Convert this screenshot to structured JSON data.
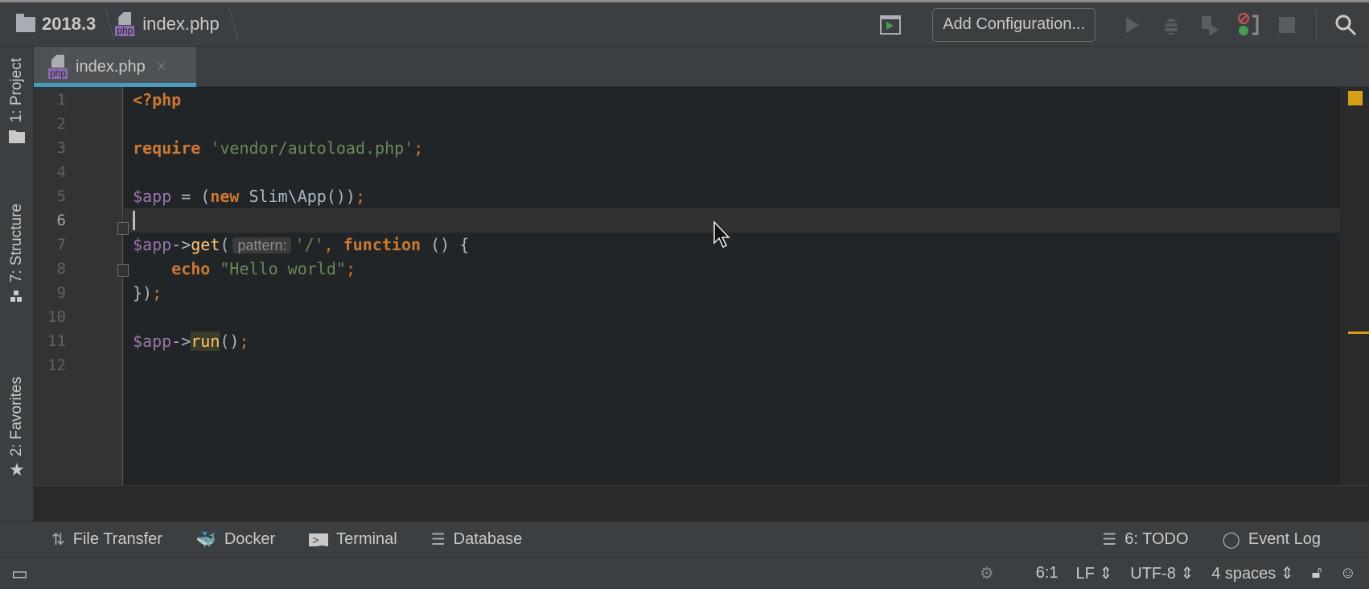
{
  "breadcrumb": {
    "project": "2018.3",
    "file": "index.php",
    "file_badge": "php"
  },
  "toolbar": {
    "add_configuration": "Add Configuration..."
  },
  "tab": {
    "label": "index.php",
    "badge": "php",
    "close": "×"
  },
  "left_tools": [
    "1: Project",
    "7: Structure",
    "2: Favorites"
  ],
  "editor": {
    "current_line": 6,
    "line_numbers": [
      "1",
      "2",
      "3",
      "4",
      "5",
      "6",
      "7",
      "8",
      "9",
      "10",
      "11",
      "12"
    ],
    "lines": [
      [
        {
          "t": "<?php",
          "c": "kw"
        }
      ],
      [],
      [
        {
          "t": "require",
          "c": "kw"
        },
        {
          "t": " "
        },
        {
          "t": "'vendor/autoload.php'",
          "c": "str"
        },
        {
          "t": ";",
          "c": "pun"
        }
      ],
      [],
      [
        {
          "t": "$app",
          "c": "var"
        },
        {
          "t": " = ("
        },
        {
          "t": "new",
          "c": "kw"
        },
        {
          "t": " Slim\\App())"
        },
        {
          "t": ";",
          "c": "pun"
        }
      ],
      [],
      [
        {
          "t": "$app",
          "c": "var"
        },
        {
          "t": "->"
        },
        {
          "t": "get",
          "c": "fn"
        },
        {
          "t": "("
        },
        {
          "t": "pattern:",
          "c": "hint"
        },
        {
          "t": "'/'",
          "c": "str"
        },
        {
          "t": ", ",
          "c": "pun"
        },
        {
          "t": "function",
          "c": "kw"
        },
        {
          "t": " () {"
        }
      ],
      [
        {
          "t": "    "
        },
        {
          "t": "echo",
          "c": "kw"
        },
        {
          "t": " "
        },
        {
          "t": "\"Hello world\"",
          "c": "str"
        },
        {
          "t": ";",
          "c": "pun"
        }
      ],
      [
        {
          "t": "})"
        },
        {
          "t": ";",
          "c": "pun"
        }
      ],
      [],
      [
        {
          "t": "$app",
          "c": "var"
        },
        {
          "t": "->"
        },
        {
          "t": "run",
          "c": "fn hl"
        },
        {
          "t": "()"
        },
        {
          "t": ";",
          "c": "pun"
        }
      ],
      []
    ]
  },
  "tool_windows": {
    "left": [
      "File Transfer",
      "Docker",
      "Terminal",
      "Database"
    ],
    "right": [
      "6: TODO",
      "Event Log"
    ]
  },
  "status": {
    "position": "6:1",
    "line_sep": "LF",
    "encoding": "UTF-8",
    "indent": "4 spaces"
  }
}
